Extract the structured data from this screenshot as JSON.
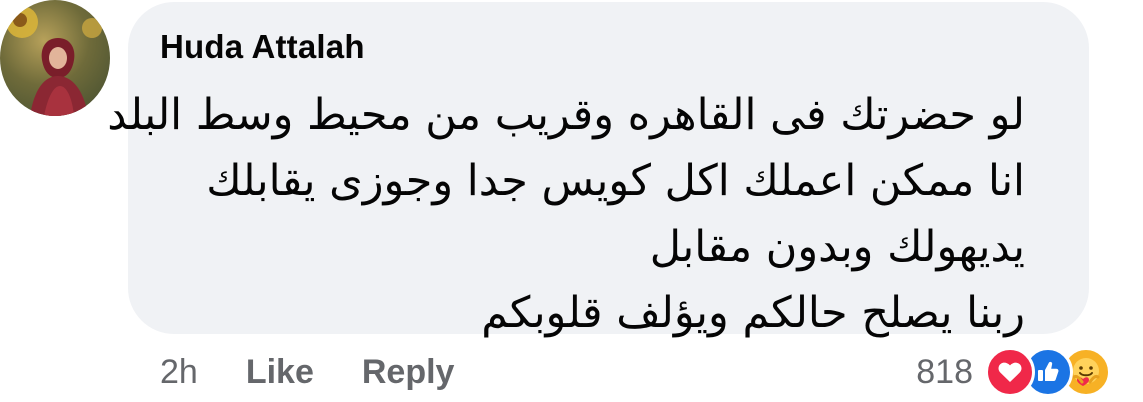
{
  "comment": {
    "author": "Huda Attalah",
    "lines": [
      "لو حضرتك فى القاهره وقريب من محيط وسط البلد",
      "انا ممكن اعملك اكل كويس جدا وجوزى يقابلك",
      "يديهولك   وبدون مقابل",
      "ربنا يصلح حالكم ويؤلف قلوبكم"
    ]
  },
  "actions": {
    "time": "2h",
    "like": "Like",
    "reply": "Reply"
  },
  "reactions": {
    "count": "818",
    "icons": [
      "heart-icon",
      "thumbs-up-icon",
      "care-icon"
    ]
  }
}
